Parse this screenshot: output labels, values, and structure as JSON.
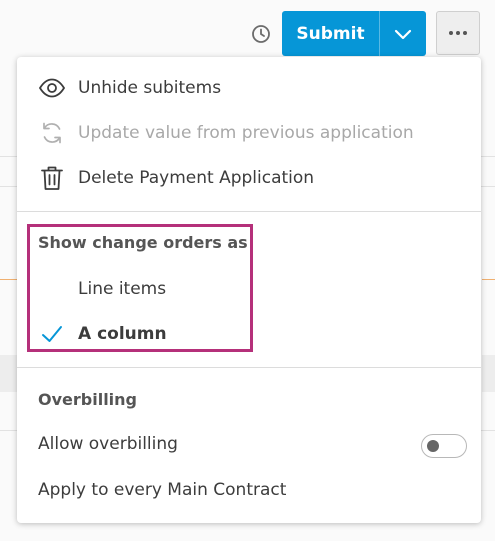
{
  "toolbar": {
    "clock_icon": "clock-icon",
    "submit_label": "Submit",
    "submit_caret_icon": "chevron-down-icon",
    "more_icon": "more-horizontal-icon",
    "accent_color": "#0696d7"
  },
  "menu": {
    "actions": [
      {
        "label": "Unhide subitems",
        "icon": "eye-icon",
        "enabled": true
      },
      {
        "label": "Update value from previous application",
        "icon": "refresh-icon",
        "enabled": false
      },
      {
        "label": "Delete Payment Application",
        "icon": "trash-icon",
        "enabled": true
      }
    ],
    "change_orders": {
      "title": "Show change orders as",
      "options": [
        {
          "label": "Line items",
          "selected": false
        },
        {
          "label": "A column",
          "selected": true
        }
      ],
      "check_icon": "checkmark-icon",
      "highlight_color": "#b5307a"
    },
    "overbilling": {
      "title": "Overbilling",
      "allow_label": "Allow overbilling",
      "allow_enabled": false,
      "apply_label": "Apply to every Main Contract"
    }
  }
}
